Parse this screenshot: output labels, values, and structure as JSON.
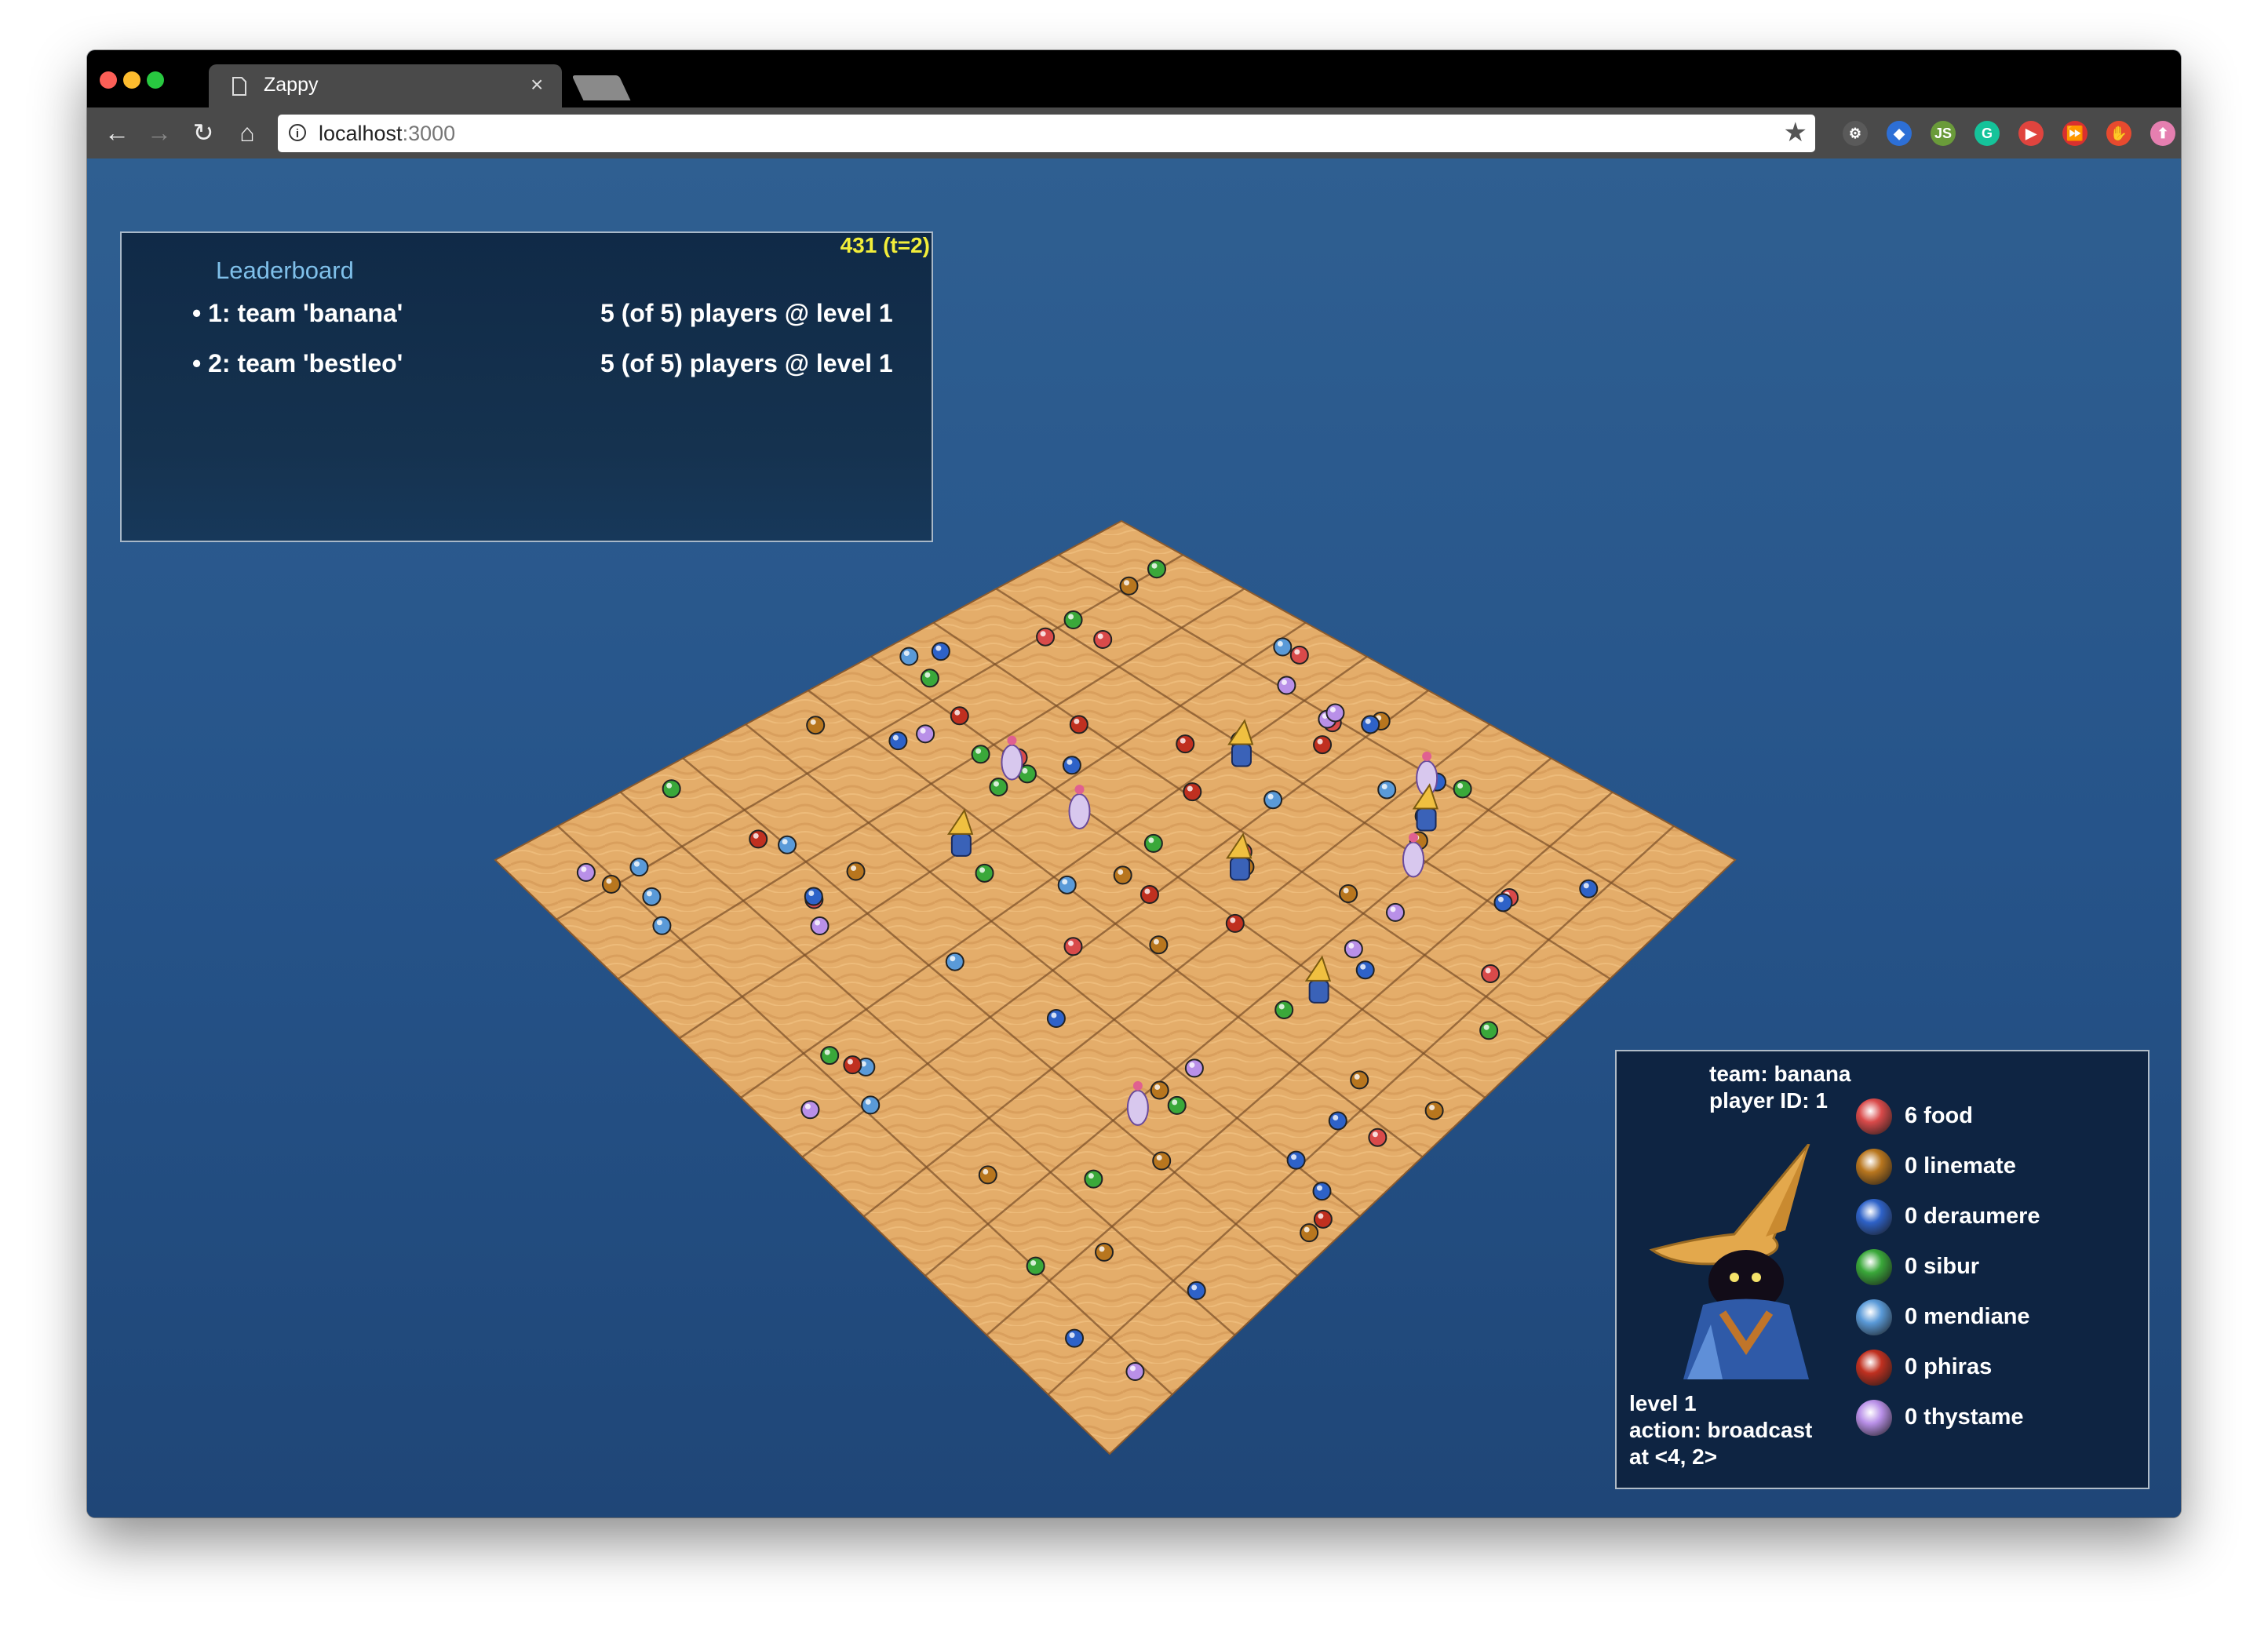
{
  "browser": {
    "tab_title": "Zappy",
    "tab_close": "×",
    "url_host": "localhost",
    "url_port": ":3000",
    "star_icon": "★",
    "traffic_colors": [
      "#fc5f57",
      "#fdbc2e",
      "#28c840"
    ],
    "extensions": [
      {
        "name": "gear-extension",
        "glyph": "⚙",
        "color": "#5a5a5a"
      },
      {
        "name": "diamond-extension",
        "glyph": "◆",
        "color": "#2d6fd6"
      },
      {
        "name": "nodejs-extension",
        "glyph": "JS",
        "color": "#6a9b3a"
      },
      {
        "name": "grammarly-extension",
        "glyph": "G",
        "color": "#15c39a"
      },
      {
        "name": "youtube-extension",
        "glyph": "▶",
        "color": "#e0443e"
      },
      {
        "name": "forward-extension",
        "glyph": "⏩",
        "color": "#d9302f"
      },
      {
        "name": "hand-extension",
        "glyph": "✋",
        "color": "#e84a2f"
      },
      {
        "name": "upload-extension",
        "glyph": "⬆",
        "color": "#e57fb0"
      }
    ]
  },
  "leaderboard": {
    "title": "Leaderboard",
    "time": "431 (t=2)",
    "teams": [
      {
        "rank_label": "• 1: team 'banana'",
        "stat": "5 (of 5) players @ level 1"
      },
      {
        "rank_label": "• 2: team 'bestleo'",
        "stat": "5 (of 5) players @ level 1"
      }
    ]
  },
  "player_panel": {
    "team": "team: banana",
    "player_id": "player ID: 1",
    "level": "level 1",
    "action": "action: broadcast",
    "position": "at <4, 2>",
    "inventory": [
      {
        "label": "6 food",
        "icon": "watermelon-icon",
        "color": "#d94a4a"
      },
      {
        "label": "0 linemate",
        "icon": "linemate-stone-icon",
        "color": "#b8761e"
      },
      {
        "label": "0 deraumere",
        "icon": "deraumere-stone-icon",
        "color": "#2e62c8"
      },
      {
        "label": "0 sibur",
        "icon": "sibur-stone-icon",
        "color": "#3aa83a"
      },
      {
        "label": "0 mendiane",
        "icon": "mendiane-stone-icon",
        "color": "#5a9ad8"
      },
      {
        "label": "0 phiras",
        "icon": "phiras-stone-icon",
        "color": "#c03020"
      },
      {
        "label": "0 thystame",
        "icon": "thystame-stone-icon",
        "color": "#b990e8"
      }
    ]
  },
  "board": {
    "size": 10,
    "tile_color": "#e4ad6a",
    "player_sprites": [
      "black-mage-sprite",
      "white-moogle-sprite"
    ]
  }
}
